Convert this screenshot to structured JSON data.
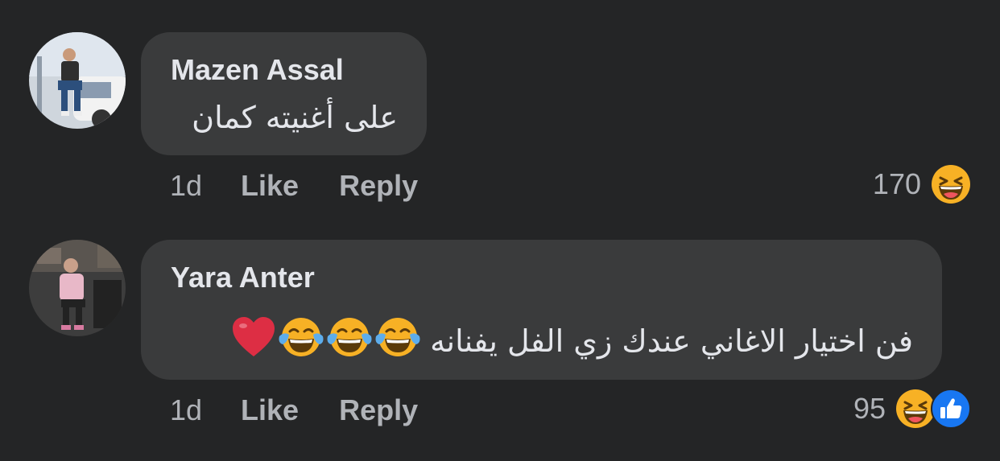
{
  "comments": [
    {
      "author": "Mazen Assal",
      "text": "على أغنيته كمان",
      "time": "1d",
      "like_label": "Like",
      "reply_label": "Reply",
      "reaction_count": "170",
      "reaction_icons": [
        "haha-icon"
      ]
    },
    {
      "author": "Yara Anter",
      "text": "فن اختيار الاغاني عندك زي الفل يفنانه",
      "text_emojis": [
        "tears-of-joy-icon",
        "tears-of-joy-icon",
        "tears-of-joy-icon",
        "red-heart-icon"
      ],
      "time": "1d",
      "like_label": "Like",
      "reply_label": "Reply",
      "reaction_count": "95",
      "reaction_icons": [
        "haha-icon",
        "like-icon"
      ]
    }
  ],
  "colors": {
    "background": "#242526",
    "bubble": "#3a3b3c",
    "primary_text": "#e4e6eb",
    "secondary_text": "#b0b3b8",
    "like_blue": "#1877f2",
    "haha_yellow": "#f7b125"
  }
}
